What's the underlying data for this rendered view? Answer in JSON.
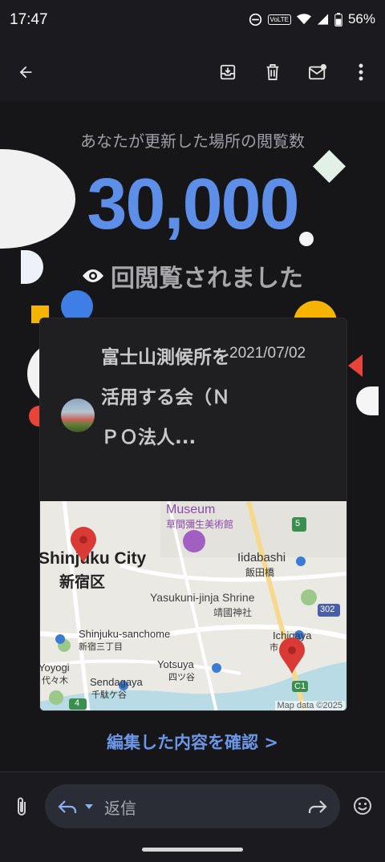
{
  "status": {
    "time": "17:47",
    "volte": "VoLTE",
    "battery": "56%"
  },
  "toolbar": {
    "icons": [
      "back-arrow-icon",
      "archive-icon",
      "delete-icon",
      "mark-unread-icon",
      "more-vert-icon"
    ]
  },
  "email": {
    "subtitle": "あなたが更新した場所の閲覧数",
    "view_count": "30,000",
    "views_label": "回閲覧されました",
    "place": {
      "name": "富士山測候所を活用する会（ＮＰＯ法人...",
      "date": "2021/07/02"
    },
    "map": {
      "labels": {
        "museum": "Museum",
        "museum_ja": "草間彌生美術館",
        "shinjuku_city": "Shinjuku City",
        "shinjuku_ku": "新宿区",
        "iidabashi": "Iidabashi",
        "iidabashi_ja": "飯田橋",
        "yasukuni": "Yasukuni-jinja Shrine",
        "yasukuni_ja": "靖國神社",
        "sanchome": "Shinjuku-sanchome",
        "sanchome_ja": "新宿三丁目",
        "ichigaya": "Ichigaya",
        "ichigaya_ja": "市",
        "yoyogi": "Yoyogi",
        "yoyogi_ja": "代々木",
        "sendagaya": "Sendagaya",
        "sendagaya_ja": "千駄ケ谷",
        "yotsuya": "Yotsuya",
        "yotsuya_ja": "四ツ谷",
        "route5": "5",
        "route302": "302",
        "route4": "4",
        "c1": "C1"
      },
      "credit": "Map data ©2025"
    },
    "confirm_link": "編集した内容を確認 >"
  },
  "reply": {
    "placeholder": "返信"
  },
  "colors": {
    "accent_blue": "#5d8fe8",
    "pin_red": "#d93a36"
  }
}
